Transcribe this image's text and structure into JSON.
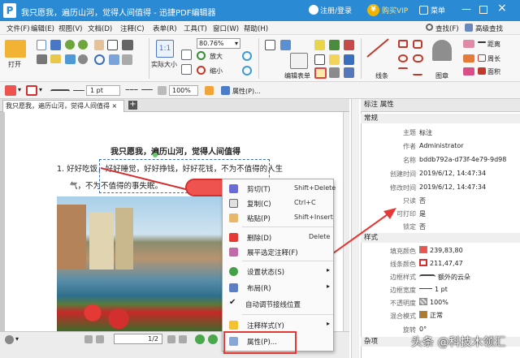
{
  "window": {
    "title": "我只愿我，遍历山河，觉得人间值得 - 迅捷PDF编辑器",
    "logo": "P",
    "login": "注册/登录",
    "vip": "购买VIP",
    "vip_coin": "¥",
    "menu": "菜单"
  },
  "menubar": {
    "items": [
      "文件(F)",
      "编辑(E)",
      "视图(V)",
      "文档(D)",
      "注释(C)",
      "表单(R)",
      "工具(T)",
      "窗口(W)",
      "帮助(H)"
    ],
    "find": "查找(F)",
    "adv_find": "高级查找"
  },
  "toolbar": {
    "open": "打开",
    "actual_size": "实际大小",
    "zoom": "80.76%",
    "zoom_in": "放大",
    "zoom_out": "缩小",
    "edit_form": "编辑表单",
    "lines": "线条",
    "stamp": "图章",
    "distance": "距离",
    "perimeter": "周长",
    "area": "面积"
  },
  "format": {
    "stroke_width": "1 pt",
    "opacity": "100%",
    "properties": "属性(P)..."
  },
  "doc": {
    "tab": "我只愿我，遍历山河，觉得人间值得",
    "tab_close": "×",
    "heading": "我只愿我，遍历山河，觉得人间值得",
    "para1": "1. 好好吃饭，好好睡觉，好好挣钱，好好花钱，不为不值得的人生",
    "para2": "气，不为不值得的事失眠。"
  },
  "status": {
    "page": "1/2"
  },
  "context_menu": [
    {
      "label": "剪切(T)",
      "shortcut": "Shift+Delete",
      "icon": "scissors-icon"
    },
    {
      "label": "复制(C)",
      "shortcut": "Ctrl+C",
      "icon": "copy-icon"
    },
    {
      "label": "粘贴(P)",
      "shortcut": "Shift+Insert",
      "icon": "paste-icon"
    },
    {
      "label": "删除(D)",
      "shortcut": "Delete",
      "icon": "delete-icon"
    },
    {
      "label": "展平选定注释(F)",
      "shortcut": "",
      "icon": "flatten-icon"
    },
    {
      "label": "设置状态(S)",
      "shortcut": "",
      "icon": "status-icon"
    },
    {
      "label": "布局(R)",
      "shortcut": "",
      "icon": "layout-icon"
    },
    {
      "label": "自动调节接线位置",
      "shortcut": "",
      "icon": "check-icon"
    },
    {
      "label": "注释样式(Y)",
      "shortcut": "",
      "icon": "style-icon"
    },
    {
      "label": "属性(P)...",
      "shortcut": "",
      "icon": "properties-icon"
    }
  ],
  "props": {
    "header": "标注 属性",
    "general": "常规",
    "style": "样式",
    "misc": "杂项",
    "rows": [
      {
        "k": "主题",
        "v": "标注"
      },
      {
        "k": "作者",
        "v": "Administrator"
      },
      {
        "k": "名称",
        "v": "bddb792a-d73f-4e79-9d98"
      },
      {
        "k": "创建时间",
        "v": "2019/6/12, 14:47:34"
      },
      {
        "k": "修改时间",
        "v": "2019/6/12, 14:47:34"
      },
      {
        "k": "只读",
        "v": "否"
      },
      {
        "k": "可打印",
        "v": "是"
      },
      {
        "k": "锁定",
        "v": "否"
      }
    ],
    "style_rows": [
      {
        "k": "填充颜色",
        "v": "239,83,80"
      },
      {
        "k": "线条颜色",
        "v": "211,47,47"
      },
      {
        "k": "边框样式",
        "v": "额外的云朵"
      },
      {
        "k": "边框宽度",
        "v": "1 pt"
      },
      {
        "k": "不透明度",
        "v": "100%"
      },
      {
        "k": "混合模式",
        "v": "正常"
      },
      {
        "k": "旋转",
        "v": "0°"
      }
    ],
    "colors": {
      "fill": "#ef5350",
      "line": "#d32f2f"
    }
  },
  "watermark": "头条 @科技木领汇"
}
